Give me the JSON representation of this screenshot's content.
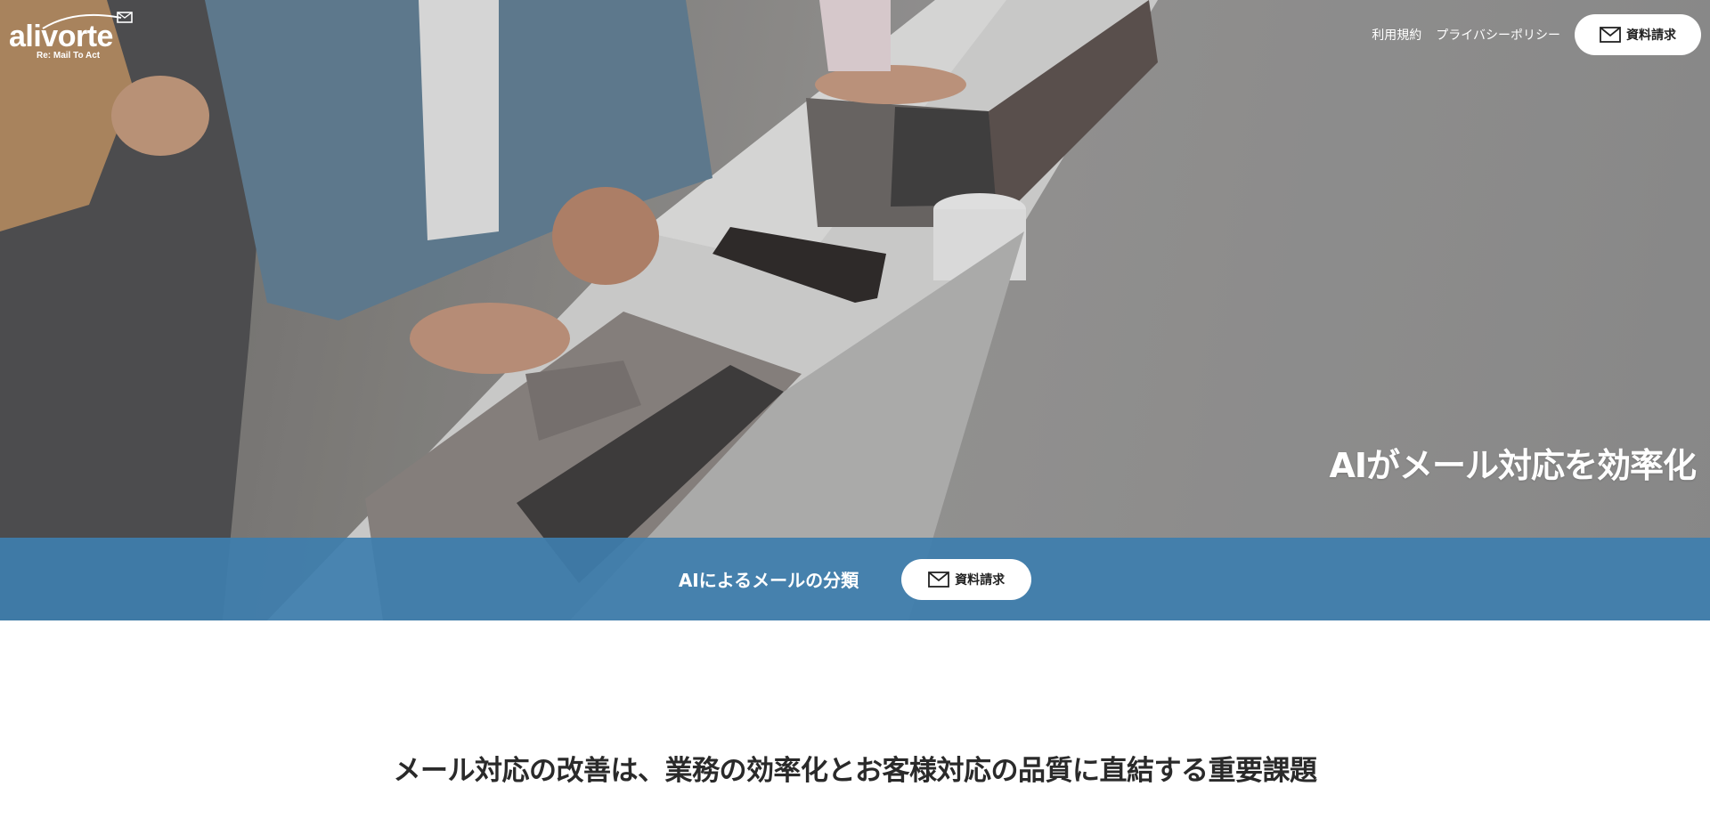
{
  "header": {
    "logo_text": "alivorte",
    "logo_tagline": "Re: Mail To Act",
    "nav": {
      "terms_label": "利用規約",
      "privacy_label": "プライバシーポリシー",
      "request_label": "資料請求"
    }
  },
  "hero": {
    "title": "AIがメール対応を効率化"
  },
  "band": {
    "text": "AIによるメールの分類",
    "request_label": "資料請求"
  },
  "main": {
    "heading": "メール対応の改善は、業務の効率化とお客様対応の品質に直結する重要課題"
  },
  "colors": {
    "band_blue": "#3e7eae",
    "white": "#ffffff",
    "text_dark": "#2a2a2a"
  },
  "icons": {
    "mail": "mail-icon",
    "logo_arc": "envelope-arc-icon"
  }
}
